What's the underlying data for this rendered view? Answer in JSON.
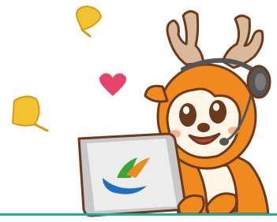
{
  "colors": {
    "background": "#ffffff",
    "outline": "#6b3a1c",
    "fur": "#f08a1e",
    "fur_shadow": "#d96f12",
    "fur_light": "#fff5e6",
    "antler": "#d9b99a",
    "antler_shadow": "#b08a6a",
    "leaf": "#f2c230",
    "leaf_edge": "#d99a12",
    "heart": "#e8446a",
    "headset": "#555555",
    "laptop_body": "#ececec",
    "laptop_frame": "#c8c8c8",
    "ground_line": "#2aa79b",
    "cheek": "#f4a07a",
    "logo_orange": "#f08a1e",
    "logo_green": "#3aa63a",
    "logo_blue": "#1e6fc0"
  },
  "icons": {
    "leaf": "ginkgo-leaf-icon",
    "heart": "heart-icon",
    "logo": "emblem-logo-icon"
  }
}
